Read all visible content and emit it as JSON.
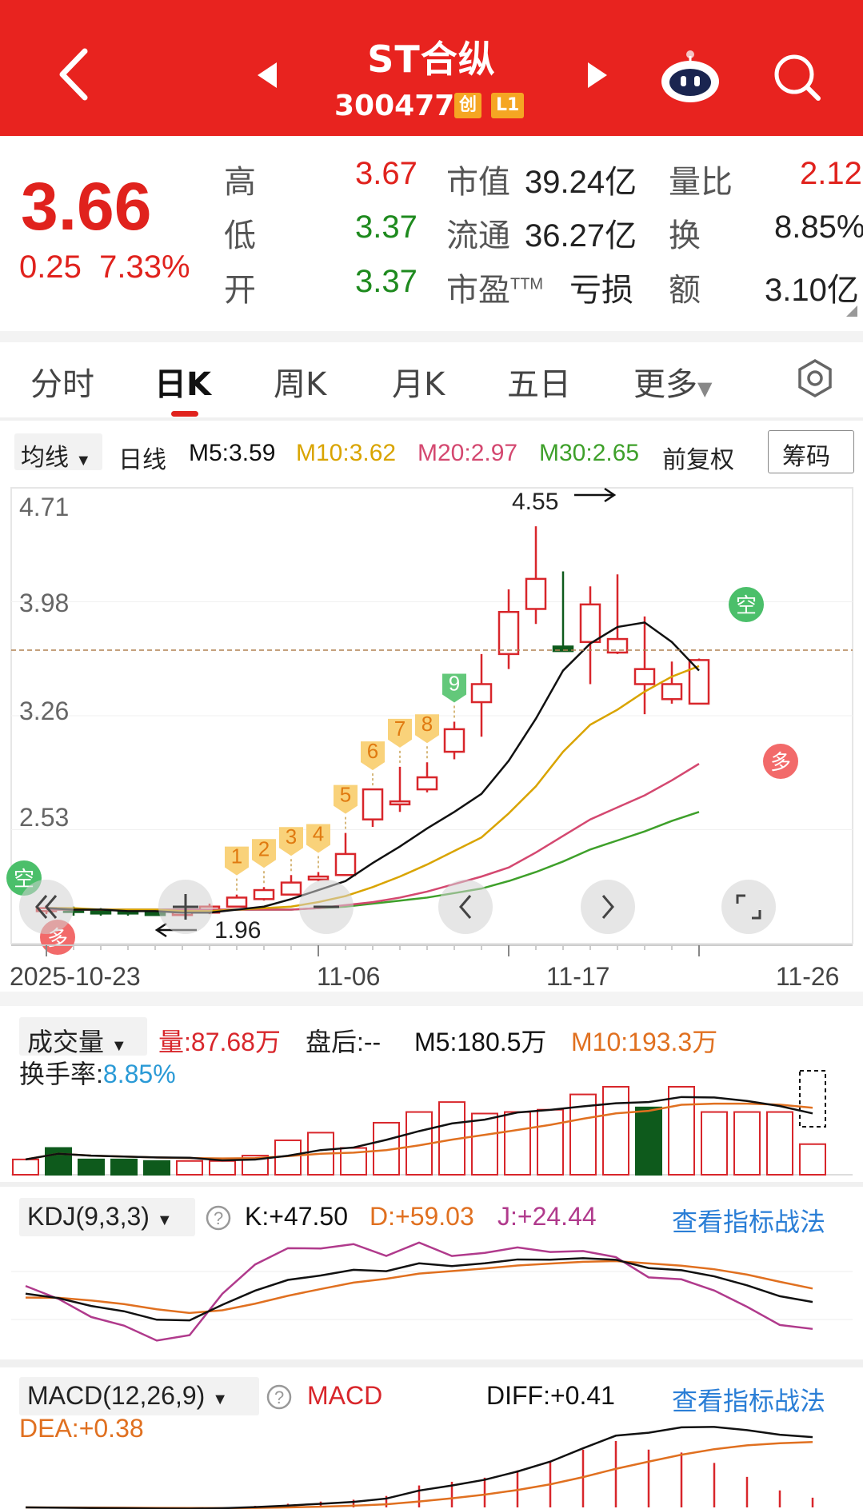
{
  "header": {
    "title": "ST合纵",
    "code": "300477",
    "badge1": "创",
    "badge2": "L1"
  },
  "quote": {
    "price": "3.66",
    "change": "0.25",
    "change_pct": "7.33%",
    "high_label": "高",
    "high": "3.67",
    "low_label": "低",
    "low": "3.37",
    "open_label": "开",
    "open": "3.37",
    "mcap_label": "市值",
    "mcap": "39.24亿",
    "float_label": "流通",
    "float": "36.27亿",
    "pe_label": "市盈",
    "pe_sup": "TTM",
    "pe": "亏损",
    "vr_label": "量比",
    "vr": "2.12",
    "turn_label": "换",
    "turn": "8.85%",
    "amt_label": "额",
    "amt": "3.10亿"
  },
  "tabs": [
    "分时",
    "日K",
    "周K",
    "月K",
    "五日",
    "更多"
  ],
  "ma_bar": {
    "selector": "均线",
    "period": "日线",
    "m5": "M5:3.59",
    "m10": "M10:3.62",
    "m20": "M20:2.97",
    "m30": "M30:2.65",
    "adjust": "前复权",
    "chips": "筹码"
  },
  "chart_labels": {
    "y1": "4.71",
    "y2": "3.98",
    "y3": "3.26",
    "y4": "2.53",
    "high_mark": "4.55",
    "low_mark": "1.96",
    "x1": "2025-10-23",
    "x2": "11-06",
    "x3": "11-17",
    "x4": "11-26"
  },
  "signal_labels": [
    "1",
    "2",
    "3",
    "4",
    "5",
    "6",
    "7",
    "8",
    "9"
  ],
  "markers": {
    "kong": "空",
    "duo": "多"
  },
  "volume": {
    "title": "成交量",
    "vol": "量:87.68万",
    "after": "盘后:-- ",
    "m5": "M5:180.5万",
    "m10": "M10:193.3万",
    "turn_label": "换手率:",
    "turn": "8.85%"
  },
  "kdj": {
    "title": "KDJ(9,3,3)",
    "k": "K:+47.50",
    "d": "D:+59.03",
    "j": "J:+24.44",
    "link": "查看指标战法"
  },
  "macd": {
    "title": "MACD(12,26,9)",
    "macd": "MACD",
    "diff": "DIFF:+0.41",
    "dea": "DEA:+0.38",
    "link": "查看指标战法"
  },
  "colors": {
    "red": "#e8231f",
    "up": "#d8262b",
    "down": "#0e5a1c",
    "m5": "#111111",
    "m10": "#d9a400",
    "m20": "#d44870",
    "m30": "#3ea02a"
  },
  "chart_data": {
    "type": "candlestick",
    "x": [
      "10-23",
      "10-24",
      "10-27",
      "10-28",
      "10-29",
      "10-30",
      "10-31",
      "11-03",
      "11-04",
      "11-05",
      "11-06",
      "11-07",
      "11-10",
      "11-11",
      "11-12",
      "11-13",
      "11-14",
      "11-17",
      "11-18",
      "11-19",
      "11-20",
      "11-21",
      "11-24",
      "11-25",
      "11-26"
    ],
    "open": [
      1.99,
      2.0,
      1.99,
      1.99,
      1.98,
      1.97,
      1.98,
      2.02,
      2.07,
      2.1,
      2.2,
      2.23,
      2.6,
      2.7,
      2.8,
      3.05,
      3.38,
      3.7,
      4.0,
      3.75,
      3.78,
      3.71,
      3.5,
      3.4,
      3.37
    ],
    "close": [
      2.01,
      1.99,
      1.98,
      1.98,
      1.97,
      1.98,
      2.02,
      2.08,
      2.13,
      2.18,
      2.22,
      2.37,
      2.8,
      2.72,
      2.88,
      3.2,
      3.5,
      3.98,
      4.2,
      3.72,
      4.03,
      3.8,
      3.6,
      3.5,
      3.66
    ],
    "high": [
      2.03,
      2.02,
      2.01,
      2.0,
      1.99,
      1.99,
      2.04,
      2.1,
      2.15,
      2.23,
      2.25,
      2.51,
      2.8,
      2.95,
      2.98,
      3.25,
      3.7,
      4.13,
      4.55,
      4.25,
      4.15,
      4.23,
      3.95,
      3.65,
      3.67
    ],
    "low": [
      1.97,
      1.96,
      1.96,
      1.96,
      1.96,
      1.96,
      1.97,
      2.02,
      2.06,
      2.1,
      2.19,
      2.23,
      2.55,
      2.65,
      2.78,
      3.0,
      3.15,
      3.6,
      3.9,
      3.72,
      3.5,
      3.7,
      3.3,
      3.37,
      3.37
    ],
    "m5": [
      2.01,
      2.0,
      2.0,
      1.99,
      1.99,
      1.98,
      1.98,
      2.0,
      2.02,
      2.07,
      2.13,
      2.19,
      2.31,
      2.42,
      2.54,
      2.65,
      2.77,
      2.99,
      3.27,
      3.59,
      3.77,
      3.88,
      3.91,
      3.78,
      3.59
    ],
    "m10": [
      2.01,
      2.01,
      2.0,
      2.0,
      2.0,
      1.99,
      1.99,
      2.0,
      2.01,
      2.02,
      2.05,
      2.09,
      2.15,
      2.22,
      2.3,
      2.39,
      2.48,
      2.64,
      2.82,
      3.05,
      3.23,
      3.33,
      3.45,
      3.55,
      3.62
    ],
    "m20": [
      2.0,
      2.0,
      2.0,
      2.0,
      2.0,
      2.0,
      2.0,
      2.0,
      2.0,
      2.0,
      2.01,
      2.03,
      2.05,
      2.08,
      2.12,
      2.17,
      2.22,
      2.28,
      2.38,
      2.49,
      2.6,
      2.68,
      2.76,
      2.86,
      2.97
    ],
    "m30": [
      2.0,
      2.0,
      2.0,
      2.0,
      2.0,
      2.0,
      2.0,
      2.0,
      2.0,
      2.0,
      2.01,
      2.02,
      2.04,
      2.06,
      2.08,
      2.11,
      2.14,
      2.19,
      2.25,
      2.32,
      2.4,
      2.46,
      2.52,
      2.59,
      2.65
    ],
    "ylim": [
      1.85,
      4.75
    ],
    "yticks": [
      4.71,
      3.98,
      3.26,
      2.53
    ],
    "volume": [
      20,
      35,
      20,
      20,
      18,
      18,
      18,
      25,
      45,
      55,
      35,
      68,
      82,
      95,
      80,
      82,
      85,
      105,
      115,
      88,
      115,
      82,
      82,
      82,
      40
    ]
  }
}
